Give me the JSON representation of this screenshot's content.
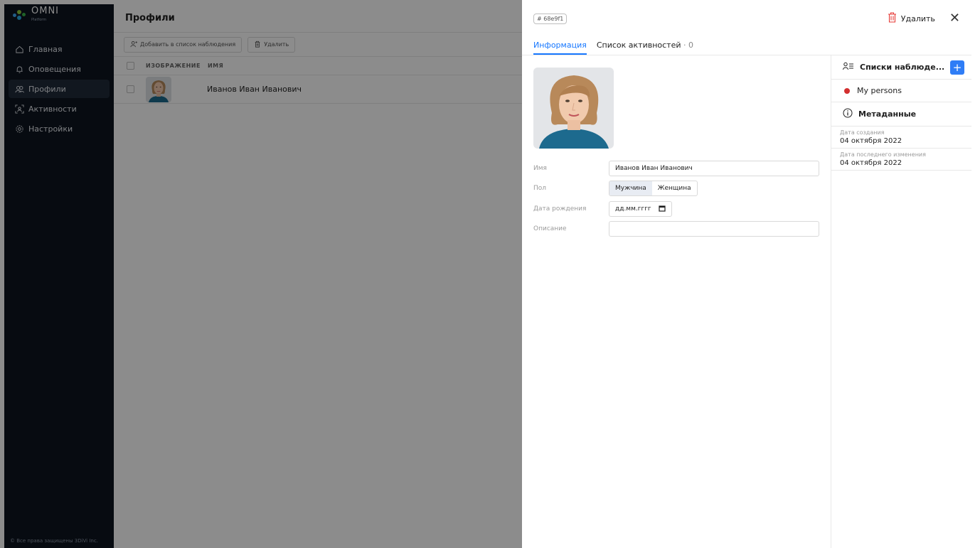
{
  "app": {
    "logo_text": "OMNI",
    "logo_sub": "Platform",
    "copyright": "© Все права защищены 3DiVi Inc."
  },
  "sidebar": {
    "items": [
      {
        "label": "Главная",
        "icon": "home-icon"
      },
      {
        "label": "Оповещения",
        "icon": "bell-icon"
      },
      {
        "label": "Профили",
        "icon": "profiles-icon",
        "active": true
      },
      {
        "label": "Активности",
        "icon": "activity-icon"
      },
      {
        "label": "Настройки",
        "icon": "gear-icon"
      }
    ]
  },
  "list": {
    "title": "Профили",
    "toolbar": {
      "add_watchlist": "Добавить в список наблюдения",
      "delete": "Удалить"
    },
    "columns": [
      "ИЗОБРАЖЕНИЕ",
      "ИМЯ"
    ],
    "rows": [
      {
        "name": "Иванов Иван Иванович"
      }
    ]
  },
  "drawer": {
    "id_badge": "# 68e9f1",
    "delete_label": "Удалить",
    "close_glyph": "✕",
    "tabs": {
      "info": "Информация",
      "activities": "Список активностей",
      "activities_count": "· 0"
    },
    "form": {
      "name_label": "Имя",
      "name_value": "Иванов Иван Иванович",
      "gender_label": "Пол",
      "gender_male": "Мужчина",
      "gender_female": "Женщина",
      "birth_label": "Дата рождения",
      "birth_placeholder": "дд.мм.гггг",
      "desc_label": "Описание",
      "desc_value": ""
    },
    "side": {
      "watchlists_title": "Списки наблюде...",
      "watchlist_item": "My persons",
      "watchlist_color": "#d32f2f",
      "meta_title": "Метаданные",
      "created_label": "Дата создания",
      "created_value": "04 октября 2022",
      "modified_label": "Дата последнего изменения",
      "modified_value": "04 октября 2022"
    }
  },
  "colors": {
    "accent": "#1677ff",
    "sidebar_bg": "#0e1520",
    "danger": "#e53935"
  }
}
